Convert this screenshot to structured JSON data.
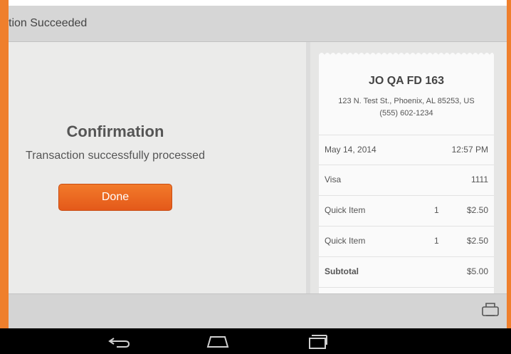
{
  "titlebar": {
    "title": "tion Succeeded"
  },
  "confirmation": {
    "title": "Confirmation",
    "message": "Transaction successfully processed",
    "done_label": "Done"
  },
  "receipt": {
    "merchant": "JO QA FD  163",
    "address_line1": "123 N. Test St., Phoenix, AL 85253, US",
    "phone": "(555) 602-1234",
    "date": "May 14, 2014",
    "time": "12:57 PM",
    "card_type": "Visa",
    "card_last4": "1111",
    "items": [
      {
        "name": "Quick Item",
        "qty": "1",
        "price": "$2.50"
      },
      {
        "name": "Quick Item",
        "qty": "1",
        "price": "$2.50"
      }
    ],
    "subtotal_label": "Subtotal",
    "subtotal_value": "$5.00"
  },
  "icons": {
    "print": "printer-icon",
    "back": "back-icon",
    "home": "home-icon",
    "recents": "recent-apps-icon"
  },
  "colors": {
    "accent": "#ef7f2c",
    "button": "#e8621f"
  }
}
